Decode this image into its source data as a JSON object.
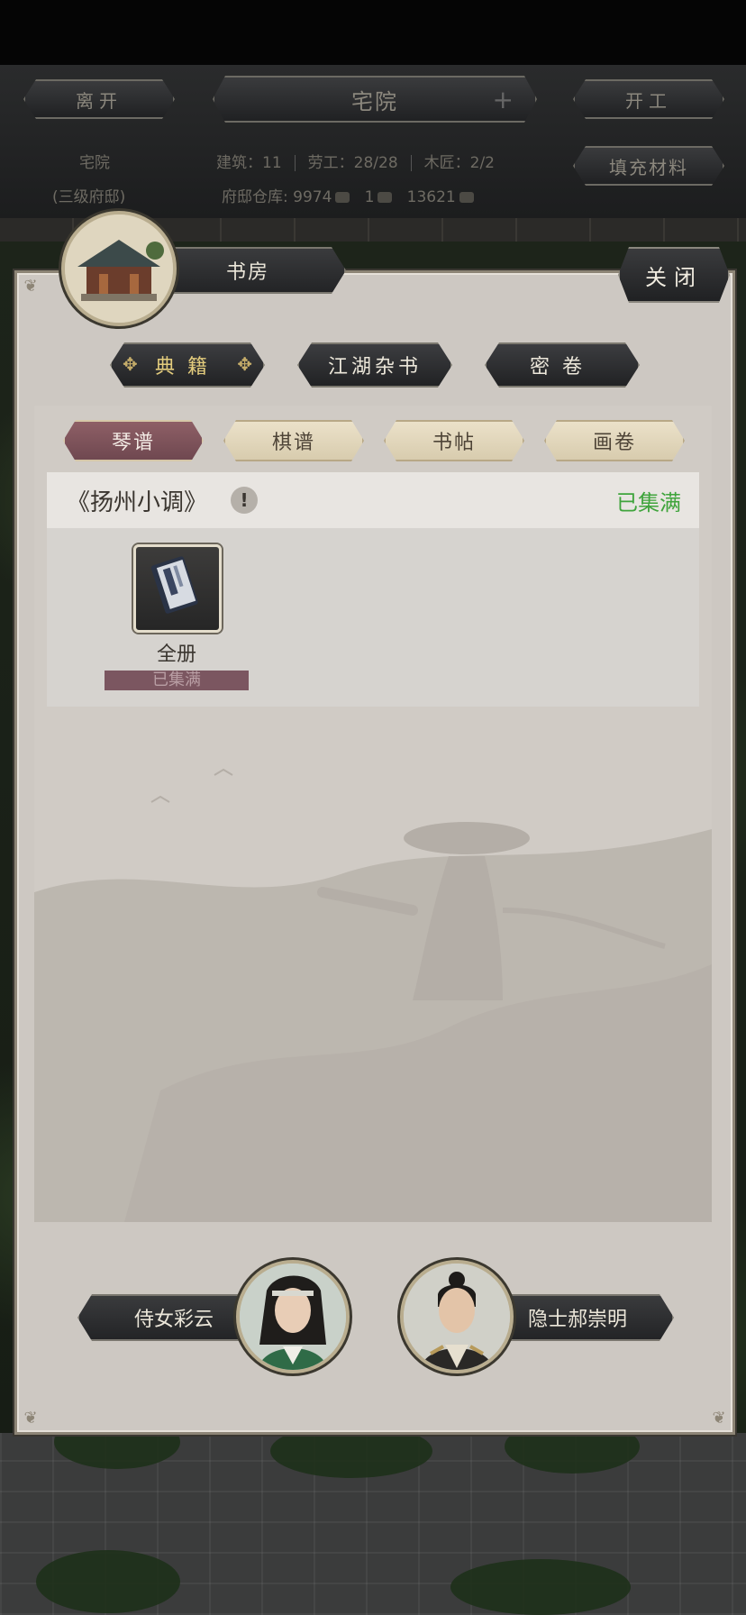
{
  "topbar": {
    "leave_label": "离开",
    "location_label": "宅院",
    "start_work_label": "开工",
    "fill_materials_label": "填充材料",
    "residence_name": "宅院",
    "residence_level": "(三级府邸)",
    "buildings": "建筑：11",
    "laborers": "劳工：28/28",
    "carpenters": "木匠：2/2",
    "warehouse_label": "府邸仓库:",
    "stock_1": "9974",
    "stock_2": "1",
    "stock_3": "13621"
  },
  "dialog": {
    "title": "书房",
    "close_label": "关闭",
    "main_tabs": [
      {
        "label": "典籍",
        "active": true
      },
      {
        "label": "江湖杂书",
        "active": false
      },
      {
        "label": "密卷",
        "active": false
      }
    ],
    "sub_tabs": [
      {
        "label": "琴谱",
        "active": true
      },
      {
        "label": "棋谱",
        "active": false
      },
      {
        "label": "书帖",
        "active": false
      },
      {
        "label": "画卷",
        "active": false
      }
    ],
    "book": {
      "title": "《扬州小调》",
      "info_icon": "!",
      "status": "已集满",
      "items": [
        {
          "label": "全册",
          "status": "已集满",
          "icon": "book-icon"
        }
      ]
    },
    "npcs": [
      {
        "name": "侍女彩云",
        "icon": "maid-portrait"
      },
      {
        "name": "隐士郝崇明",
        "icon": "hermit-portrait"
      }
    ]
  },
  "colors": {
    "accent_gold": "#e3cc7d",
    "active_subtab": "#7b5660",
    "status_green": "#3fa43c",
    "panel_bg": "#cdc8c2"
  }
}
